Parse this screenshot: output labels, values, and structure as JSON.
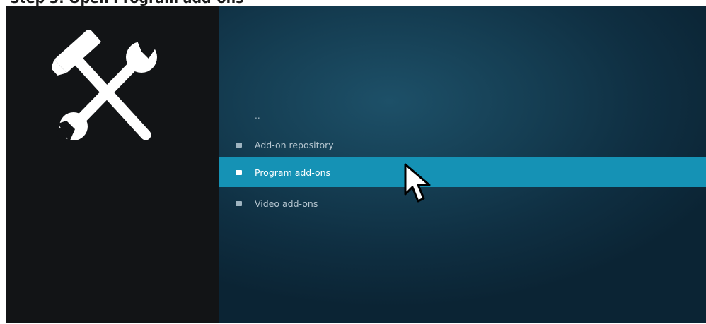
{
  "page": {
    "cropped_caption": "Step 3: Open Program add-ons"
  },
  "sidebar": {
    "icon": "tools-icon"
  },
  "list": {
    "parent_label": "..",
    "items": [
      {
        "label": "Add-on repository",
        "icon": "folder-icon",
        "selected": false
      },
      {
        "label": "Program add-ons",
        "icon": "folder-icon",
        "selected": true
      },
      {
        "label": "Video add-ons",
        "icon": "folder-icon",
        "selected": false
      }
    ]
  },
  "colors": {
    "sidebar_bg": "#121416",
    "main_bg": "#153e53",
    "highlight": "#1592b5",
    "text": "#b6c6d0",
    "selected_text": "#ffffff"
  },
  "cursor": {
    "icon": "mouse-pointer-icon"
  }
}
